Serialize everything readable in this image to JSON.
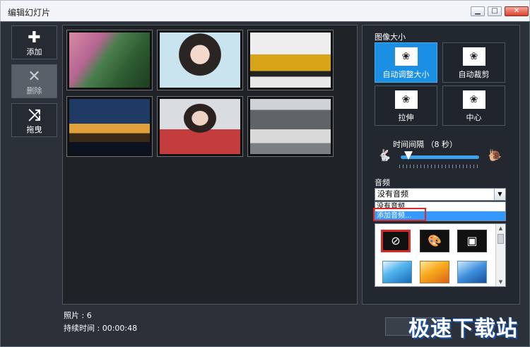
{
  "window": {
    "title": "编辑幻灯片",
    "min_glyph": "▁",
    "max_glyph": "□",
    "close_glyph": "✕"
  },
  "toolbar": [
    {
      "label": "添加",
      "icon": "plus-icon",
      "glyph": "✚"
    },
    {
      "label": "删除",
      "icon": "close-icon",
      "glyph": "✕",
      "disabled": true
    },
    {
      "label": "拖曳",
      "icon": "shuffle-icon",
      "glyph": "⤨"
    }
  ],
  "photos": [
    {
      "icon": "aerial-forest-photo"
    },
    {
      "icon": "portrait-woman-photo"
    },
    {
      "icon": "yellow-suv-photo"
    },
    {
      "icon": "night-castle-photo"
    },
    {
      "icon": "woman-red-dress-photo"
    },
    {
      "icon": "white-sportscar-photo"
    }
  ],
  "info": {
    "photo_count": "照片 : 6",
    "duration": "持续时间 : 00:00:48"
  },
  "image_size": {
    "title": "图像大小",
    "options": [
      {
        "label": "自动调整大小",
        "icon": "auto-resize-icon",
        "glyph": "❀",
        "active": true
      },
      {
        "label": "自动裁剪",
        "icon": "auto-crop-icon",
        "glyph": "❀"
      },
      {
        "label": "拉伸",
        "icon": "stretch-icon",
        "glyph": "❀"
      },
      {
        "label": "中心",
        "icon": "center-icon",
        "glyph": "❀"
      }
    ]
  },
  "interval": {
    "label": "时间间隔 （8 秒）",
    "value_seconds": 8,
    "fast_icon": "rabbit-icon",
    "slow_icon": "snail-icon",
    "fast_glyph": "🐇",
    "slow_glyph": "🐌",
    "level": 0.1
  },
  "audio": {
    "title": "音频",
    "selected": "没有音频",
    "options": [
      "没有音频",
      "添加音频..."
    ],
    "highlighted": 1
  },
  "effects": [
    {
      "icon": "no-camera-icon",
      "glyph": "⊘",
      "selected": true
    },
    {
      "icon": "palette-icon",
      "glyph": "🎨"
    },
    {
      "icon": "image-icon",
      "glyph": "▣"
    },
    {
      "icon": "blue-wave-icon",
      "glyph": ""
    },
    {
      "icon": "orange-wave-icon",
      "glyph": ""
    },
    {
      "icon": "blue-gradient-icon",
      "glyph": ""
    }
  ],
  "watermark": "极速下载站",
  "colors": {
    "accent": "#1a8fe3",
    "background": "#2b3039",
    "highlight": "#3399ff",
    "callout": "#d92a2a"
  }
}
